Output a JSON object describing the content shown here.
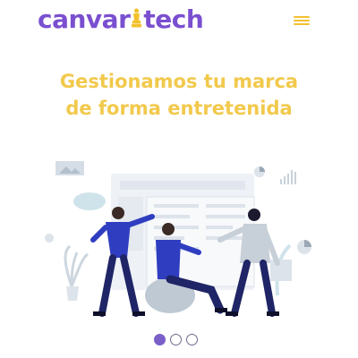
{
  "header": {
    "logo": {
      "part1": "canvar",
      "part2": "tech"
    },
    "menu_icon": "hamburger-menu-icon",
    "colors": {
      "brand_purple": "#7a4fd0",
      "brand_yellow": "#f2c12e"
    }
  },
  "hero": {
    "headline_line1": "Gestionamos tu marca",
    "headline_line2": "de forma entretenida",
    "headline_color": "#f2c94c",
    "illustration": "team-collaboration-illustration"
  },
  "carousel": {
    "active_index": 0,
    "dots": [
      "slide-1",
      "slide-2",
      "slide-3"
    ]
  }
}
